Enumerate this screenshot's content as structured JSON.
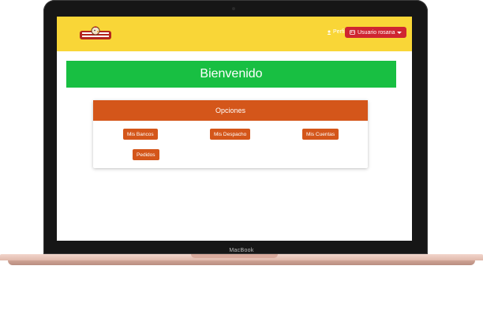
{
  "device": {
    "brand_label": "MacBook"
  },
  "navbar": {
    "logo_icon": "restaurant-chicken-logo",
    "perfil_label": "Perfil",
    "perfil_icon": "user-icon",
    "user_label": "Usuario rosana",
    "user_icon": "id-card-icon"
  },
  "welcome": {
    "title": "Bienvenido"
  },
  "options_card": {
    "header": "Opciones",
    "buttons": [
      "Mis Bancos",
      "Mis Despacho",
      "Mis Cuentas",
      "Pedidos"
    ]
  },
  "colors": {
    "navbar": "#f9d637",
    "welcome": "#18bf42",
    "accent_orange": "#d4561a",
    "user_button": "#cf2531"
  }
}
